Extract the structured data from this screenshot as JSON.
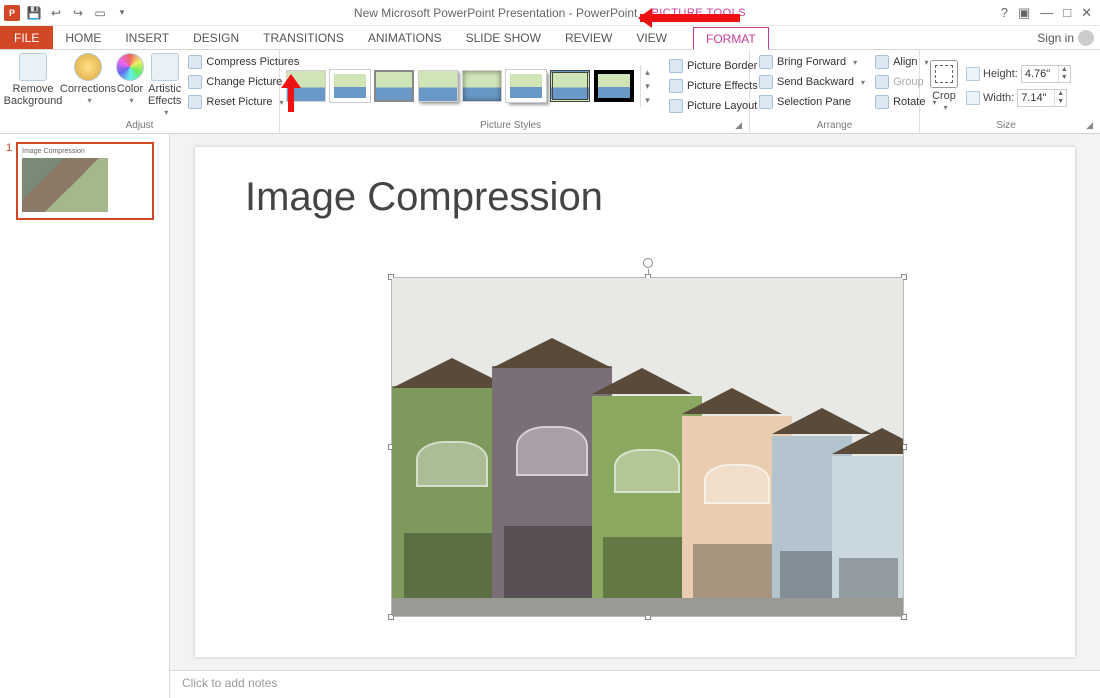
{
  "titlebar": {
    "document_title": "New Microsoft PowerPoint Presentation - PowerPoint",
    "contextual_label": "PICTURE TOOLS"
  },
  "tabs": {
    "file": "FILE",
    "items": [
      "HOME",
      "INSERT",
      "DESIGN",
      "TRANSITIONS",
      "ANIMATIONS",
      "SLIDE SHOW",
      "REVIEW",
      "VIEW"
    ],
    "contextual": "FORMAT",
    "signin": "Sign in"
  },
  "ribbon": {
    "adjust": {
      "remove_bg": "Remove Background",
      "corrections": "Corrections",
      "color": "Color",
      "artistic": "Artistic Effects",
      "compress": "Compress Pictures",
      "change": "Change Picture",
      "reset": "Reset Picture",
      "label": "Adjust"
    },
    "pstyles": {
      "border": "Picture Border",
      "effects": "Picture Effects",
      "layout": "Picture Layout",
      "label": "Picture Styles"
    },
    "arrange": {
      "bring_forward": "Bring Forward",
      "send_backward": "Send Backward",
      "selection_pane": "Selection Pane",
      "align": "Align",
      "group": "Group",
      "rotate": "Rotate",
      "label": "Arrange"
    },
    "size": {
      "crop": "Crop",
      "height_label": "Height:",
      "height_value": "4.76\"",
      "width_label": "Width:",
      "width_value": "7.14\"",
      "label": "Size"
    }
  },
  "thumbnails": {
    "slide1_num": "1",
    "slide1_title": "Image Compression"
  },
  "slide": {
    "title": "Image Compression"
  },
  "notes": {
    "placeholder": "Click to add notes"
  }
}
